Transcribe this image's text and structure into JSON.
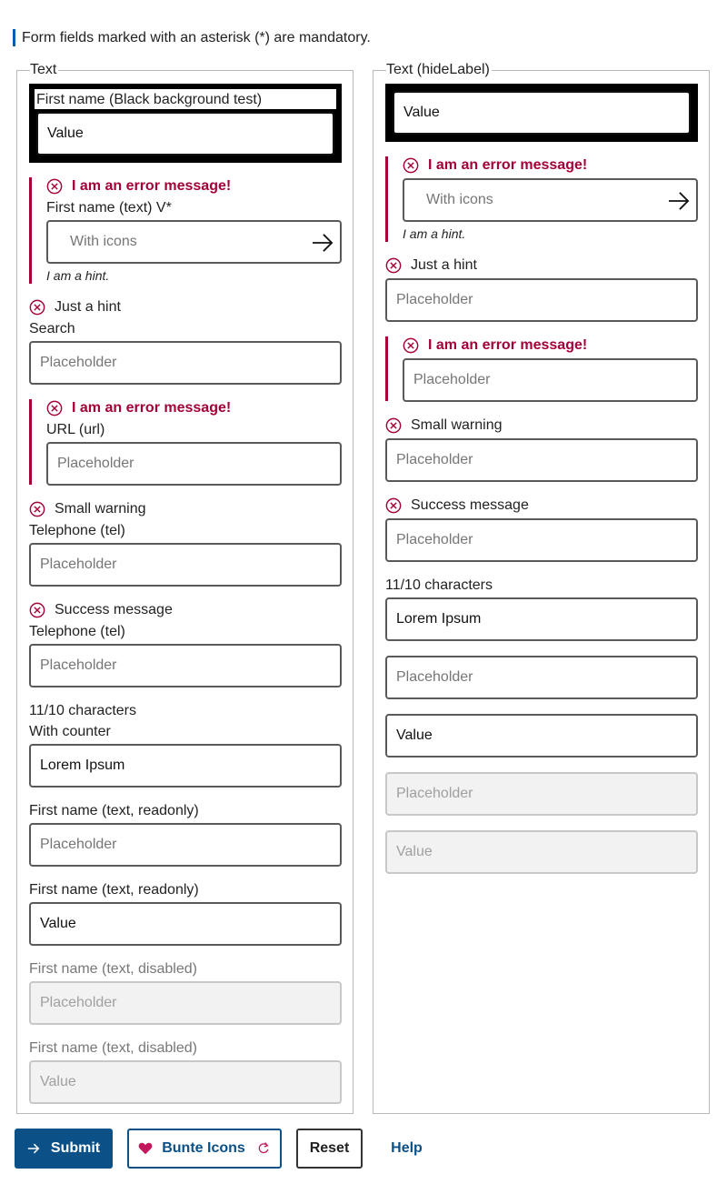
{
  "notice": "Form fields marked with an asterisk (*) are mandatory.",
  "left": {
    "legend": "Text",
    "black_label": "First name (Black background test)",
    "black_value": "Value",
    "error1": "I am an error message!",
    "icons_label": "First name (text) V",
    "required_mark": "*",
    "icons_placeholder": "With icons",
    "hint": "I am a hint.",
    "hint_msg": "Just a hint",
    "search_label": "Search",
    "search_placeholder": "Placeholder",
    "error2": "I am an error message!",
    "url_label": "URL (url)",
    "url_placeholder": "Placeholder",
    "warn_msg": "Small warning",
    "tel1_label": "Telephone (tel)",
    "tel1_placeholder": "Placeholder",
    "success_msg": "Success message",
    "tel2_label": "Telephone (tel)",
    "tel2_placeholder": "Placeholder",
    "counter_msg": "11/10 characters",
    "counter_label": "With counter",
    "counter_value": "Lorem Ipsum",
    "ro1_label": "First name (text, readonly)",
    "ro1_placeholder": "Placeholder",
    "ro2_label": "First name (text, readonly)",
    "ro2_value": "Value",
    "dis1_label": "First name (text, disabled)",
    "dis1_placeholder": "Placeholder",
    "dis2_label": "First name (text, disabled)",
    "dis2_value": "Value"
  },
  "right": {
    "legend": "Text (hideLabel)",
    "black_value": "Value",
    "error1": "I am an error message!",
    "icons_placeholder": "With icons",
    "hint": "I am a hint.",
    "hint_msg": "Just a hint",
    "hint_placeholder": "Placeholder",
    "error2": "I am an error message!",
    "error2_placeholder": "Placeholder",
    "warn_msg": "Small warning",
    "warn_placeholder": "Placeholder",
    "success_msg": "Success message",
    "success_placeholder": "Placeholder",
    "counter_msg": "11/10 characters",
    "counter_value": "Lorem Ipsum",
    "ro1_placeholder": "Placeholder",
    "ro2_value": "Value",
    "dis1_placeholder": "Placeholder",
    "dis2_value": "Value"
  },
  "buttons": {
    "submit": "Submit",
    "bunte": "Bunte Icons",
    "reset": "Reset",
    "help": "Help"
  },
  "colors": {
    "error": "#a4003a",
    "primary": "#0b5087",
    "accent_pink": "#c2185b"
  }
}
